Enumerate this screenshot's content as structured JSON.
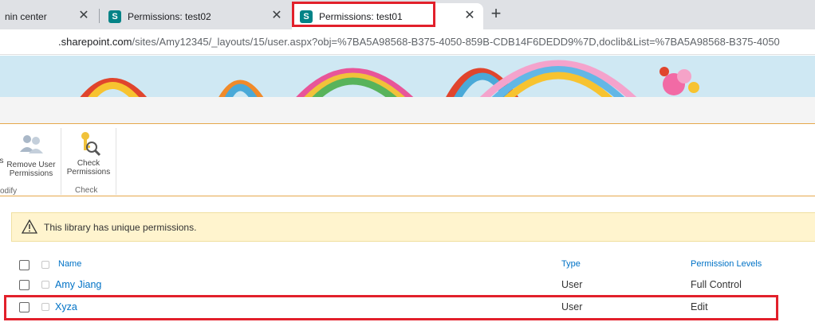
{
  "browser": {
    "tabs": [
      {
        "title": "nin center"
      },
      {
        "title": "Permissions: test02",
        "favicon": "S"
      },
      {
        "title": "Permissions: test01",
        "favicon": "S",
        "active": true
      }
    ],
    "url_domain": ".sharepoint.com",
    "url_path": "/sites/Amy12345/_layouts/15/user.aspx?obj=%7BA5A98568-B375-4050-859B-CDB14F6DEDD9%7D,doclib&List=%7BA5A98568-B375-4050",
    "new_tab_symbol": "+",
    "close_symbol": "✕"
  },
  "ribbon": {
    "remove_user_line1": "Remove User",
    "remove_user_line2": "Permissions",
    "check_line1": "Check",
    "check_line2": "Permissions",
    "modify_group": "odify",
    "check_group": "Check",
    "cut_label": "s"
  },
  "notice": {
    "text": "This library has unique permissions."
  },
  "table": {
    "headers": {
      "name": "Name",
      "type": "Type",
      "levels": "Permission Levels"
    },
    "rows": [
      {
        "name": "Amy Jiang",
        "type": "User",
        "level": "Full Control"
      },
      {
        "name": "Xyza",
        "type": "User",
        "level": "Edit"
      }
    ]
  },
  "colors": {
    "highlight": "#e2202b",
    "link": "#0072c6",
    "sharepoint": "#038387",
    "notice_bg": "#fff4ce"
  }
}
